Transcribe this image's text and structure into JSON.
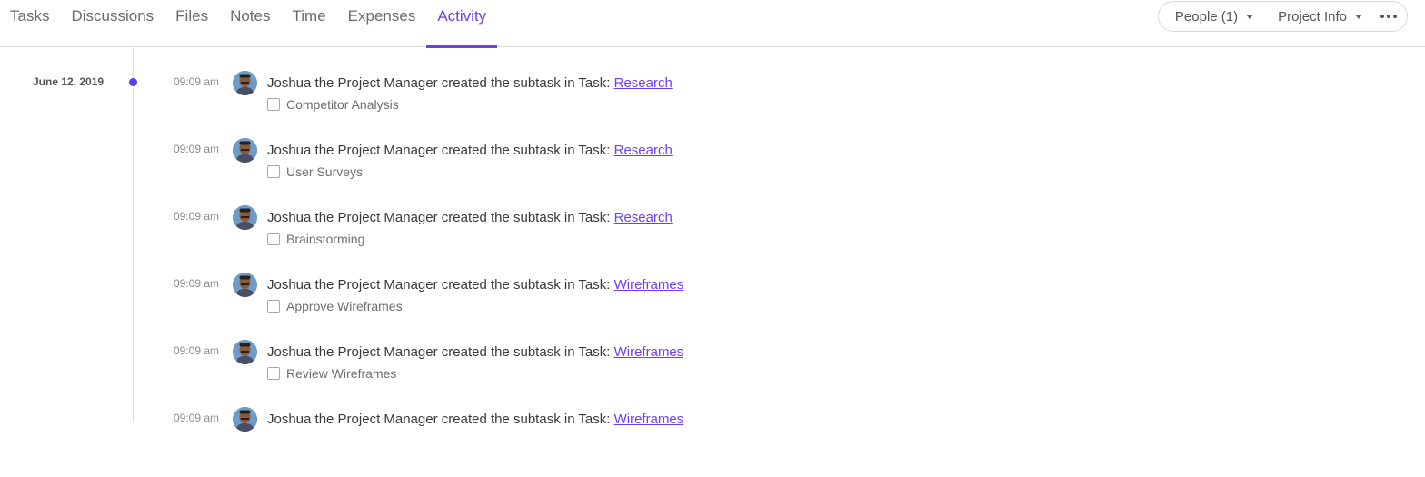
{
  "tabs": [
    {
      "label": "Tasks",
      "active": false
    },
    {
      "label": "Discussions",
      "active": false
    },
    {
      "label": "Files",
      "active": false
    },
    {
      "label": "Notes",
      "active": false
    },
    {
      "label": "Time",
      "active": false
    },
    {
      "label": "Expenses",
      "active": false
    },
    {
      "label": "Activity",
      "active": true
    }
  ],
  "actions": {
    "people_label": "People (1)",
    "project_info_label": "Project Info",
    "more_icon": "more-dots-icon"
  },
  "colors": {
    "accent": "#6c3ff5",
    "timeline_dot": "#5b3cf5"
  },
  "timeline": {
    "date": "June 12. 2019",
    "entries": [
      {
        "time": "09:09 am",
        "text": "Joshua the Project Manager created the subtask in Task: ",
        "task": "Research",
        "subtask": "Competitor Analysis"
      },
      {
        "time": "09:09 am",
        "text": "Joshua the Project Manager created the subtask in Task: ",
        "task": "Research",
        "subtask": "User Surveys"
      },
      {
        "time": "09:09 am",
        "text": "Joshua the Project Manager created the subtask in Task: ",
        "task": "Research",
        "subtask": "Brainstorming"
      },
      {
        "time": "09:09 am",
        "text": "Joshua the Project Manager created the subtask in Task: ",
        "task": "Wireframes",
        "subtask": "Approve Wireframes"
      },
      {
        "time": "09:09 am",
        "text": "Joshua the Project Manager created the subtask in Task: ",
        "task": "Wireframes",
        "subtask": "Review Wireframes"
      },
      {
        "time": "09:09 am",
        "text": "Joshua the Project Manager created the subtask in Task: ",
        "task": "Wireframes",
        "subtask": ""
      }
    ]
  }
}
